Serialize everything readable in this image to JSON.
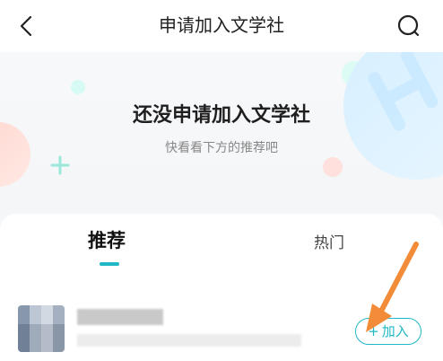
{
  "header": {
    "title": "申请加入文学社",
    "back_icon": "chevron-left-icon",
    "search_icon": "search-icon"
  },
  "hero": {
    "title": "还没申请加入文学社",
    "subtitle": "快看看下方的推荐吧"
  },
  "tabs": [
    {
      "label": "推荐",
      "active": true
    },
    {
      "label": "热门",
      "active": false
    }
  ],
  "list": [
    {
      "join_button": {
        "plus": "+",
        "label": "加入"
      }
    }
  ],
  "colors": {
    "accent": "#20b8c5",
    "annotation": "#f28c38",
    "hero_background": "#f4f6f8"
  }
}
